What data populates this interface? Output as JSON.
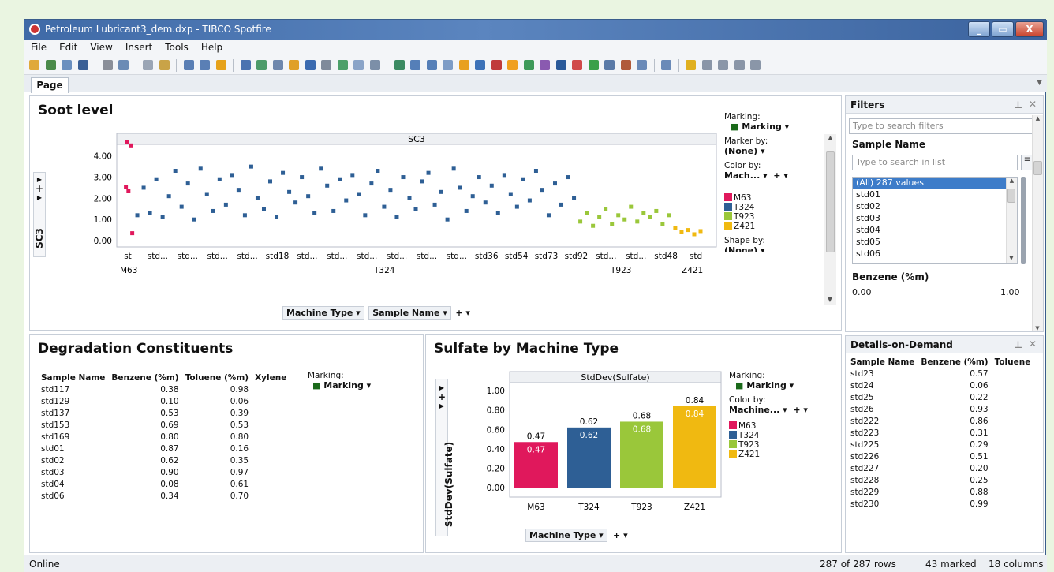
{
  "window": {
    "title": "Petroleum Lubricant3_dem.dxp - TIBCO Spotfire"
  },
  "menu": [
    "File",
    "Edit",
    "View",
    "Insert",
    "Tools",
    "Help"
  ],
  "tabs": [
    "Page"
  ],
  "soot": {
    "title": "Soot level",
    "plot_title": "SC3",
    "ylabel": "SC3",
    "yticks": [
      "4.00",
      "3.00",
      "2.00",
      "1.00",
      "0.00"
    ],
    "xticks": [
      "st",
      "std...",
      "std...",
      "std...",
      "std...",
      "std18",
      "std...",
      "std...",
      "std...",
      "std...",
      "std...",
      "std...",
      "std36",
      "std54",
      "std73",
      "std92",
      "std...",
      "std...",
      "std48",
      "std"
    ],
    "groups": [
      "M63",
      "T324",
      "T923",
      "Z421"
    ],
    "axis_controls": [
      "Machine Type",
      "Sample Name"
    ],
    "marking_label": "Marking:",
    "marking_value": "Marking",
    "marker_by_label": "Marker by:",
    "marker_by_value": "(None)",
    "color_by_label": "Color by:",
    "color_by_value": "Mach...",
    "legend": [
      "M63",
      "T324",
      "T923",
      "Z421"
    ],
    "shape_by_label": "Shape by:",
    "shape_by_value": "(None)"
  },
  "degradation": {
    "title": "Degradation Constituents",
    "columns": [
      "Sample Name",
      "Benzene (%m)",
      "Toluene (%m)",
      "Xylene"
    ],
    "rows": [
      [
        "std117",
        "0.38",
        "0.98"
      ],
      [
        "std129",
        "0.10",
        "0.06"
      ],
      [
        "std137",
        "0.53",
        "0.39"
      ],
      [
        "std153",
        "0.69",
        "0.53"
      ],
      [
        "std169",
        "0.80",
        "0.80"
      ],
      [
        "std01",
        "0.87",
        "0.16"
      ],
      [
        "std02",
        "0.62",
        "0.35"
      ],
      [
        "std03",
        "0.90",
        "0.97"
      ],
      [
        "std04",
        "0.08",
        "0.61"
      ],
      [
        "std06",
        "0.34",
        "0.70"
      ]
    ],
    "marking_label": "Marking:",
    "marking_value": "Marking"
  },
  "sulfate": {
    "title": "Sulfate by Machine Type",
    "plot_title": "StdDev(Sulfate)",
    "ylabel": "StdDev(Sulfate)",
    "axis_control": "Machine Type",
    "marking_label": "Marking:",
    "marking_value": "Marking",
    "color_by_label": "Color by:",
    "color_by_value": "Machine...",
    "legend": [
      "M63",
      "T324",
      "T923",
      "Z421"
    ]
  },
  "filters": {
    "title": "Filters",
    "search_placeholder": "Type to search filters",
    "sample_name_label": "Sample Name",
    "list_placeholder": "Type to search in list",
    "items": [
      "(All) 287 values",
      "std01",
      "std02",
      "std03",
      "std04",
      "std05",
      "std06"
    ],
    "benzene_label": "Benzene (%m)",
    "benzene_min": "0.00",
    "benzene_max": "1.00"
  },
  "details": {
    "title": "Details-on-Demand",
    "columns": [
      "Sample Name",
      "Benzene (%m)",
      "Toluene"
    ],
    "rows": [
      [
        "std23",
        "0.57"
      ],
      [
        "std24",
        "0.06"
      ],
      [
        "std25",
        "0.22"
      ],
      [
        "std26",
        "0.93"
      ],
      [
        "std222",
        "0.86"
      ],
      [
        "std223",
        "0.31"
      ],
      [
        "std225",
        "0.29"
      ],
      [
        "std226",
        "0.51"
      ],
      [
        "std227",
        "0.20"
      ],
      [
        "std228",
        "0.25"
      ],
      [
        "std229",
        "0.88"
      ],
      [
        "std230",
        "0.99"
      ]
    ]
  },
  "status": {
    "left": "Online",
    "rows": "287 of 287 rows",
    "marked": "43 marked",
    "columns": "18 columns"
  },
  "colors": {
    "M63": "#e0185c",
    "T324": "#2e5f95",
    "T923": "#9ac73a",
    "Z421": "#f0b911",
    "accent": "#3b6fb6"
  },
  "chart_data": [
    {
      "type": "scatter",
      "title": "SC3",
      "ylabel": "SC3",
      "xlabel": "",
      "ylim": [
        0,
        4.4
      ],
      "categories": [
        "M63",
        "T324",
        "T923",
        "Z421"
      ],
      "series": [
        {
          "name": "M63",
          "points": [
            [
              0.2,
              4.65
            ],
            [
              0.5,
              4.5
            ],
            [
              0.1,
              2.55
            ],
            [
              0.3,
              2.35
            ],
            [
              0.6,
              0.35
            ]
          ]
        },
        {
          "name": "T324",
          "points": [
            [
              1,
              1.2
            ],
            [
              1.5,
              2.5
            ],
            [
              2,
              1.3
            ],
            [
              2.5,
              2.9
            ],
            [
              3,
              1.1
            ],
            [
              3.5,
              2.1
            ],
            [
              4,
              3.3
            ],
            [
              4.5,
              1.6
            ],
            [
              5,
              2.7
            ],
            [
              5.5,
              1.0
            ],
            [
              6,
              3.4
            ],
            [
              6.5,
              2.2
            ],
            [
              7,
              1.4
            ],
            [
              7.5,
              2.9
            ],
            [
              8,
              1.7
            ],
            [
              8.5,
              3.1
            ],
            [
              9,
              2.4
            ],
            [
              9.5,
              1.2
            ],
            [
              10,
              3.5
            ],
            [
              10.5,
              2.0
            ],
            [
              11,
              1.5
            ],
            [
              11.5,
              2.8
            ],
            [
              12,
              1.1
            ],
            [
              12.5,
              3.2
            ],
            [
              13,
              2.3
            ],
            [
              13.5,
              1.8
            ],
            [
              14,
              3.0
            ],
            [
              14.5,
              2.1
            ],
            [
              15,
              1.3
            ],
            [
              15.5,
              3.4
            ],
            [
              16,
              2.6
            ],
            [
              16.5,
              1.4
            ],
            [
              17,
              2.9
            ],
            [
              17.5,
              1.9
            ],
            [
              18,
              3.1
            ],
            [
              18.5,
              2.2
            ],
            [
              19,
              1.2
            ],
            [
              19.5,
              2.7
            ],
            [
              20,
              3.3
            ],
            [
              20.5,
              1.6
            ],
            [
              21,
              2.4
            ],
            [
              21.5,
              1.1
            ],
            [
              22,
              3.0
            ],
            [
              22.5,
              2.0
            ],
            [
              23,
              1.5
            ],
            [
              23.5,
              2.8
            ],
            [
              24,
              3.2
            ],
            [
              24.5,
              1.7
            ],
            [
              25,
              2.3
            ],
            [
              25.5,
              1.0
            ],
            [
              26,
              3.4
            ],
            [
              26.5,
              2.5
            ],
            [
              27,
              1.4
            ],
            [
              27.5,
              2.1
            ],
            [
              28,
              3.0
            ],
            [
              28.5,
              1.8
            ],
            [
              29,
              2.6
            ],
            [
              29.5,
              1.3
            ],
            [
              30,
              3.1
            ],
            [
              30.5,
              2.2
            ],
            [
              31,
              1.6
            ],
            [
              31.5,
              2.9
            ],
            [
              32,
              1.9
            ],
            [
              32.5,
              3.3
            ],
            [
              33,
              2.4
            ],
            [
              33.5,
              1.2
            ],
            [
              34,
              2.7
            ],
            [
              34.5,
              1.7
            ],
            [
              35,
              3.0
            ],
            [
              35.5,
              2.0
            ]
          ]
        },
        {
          "name": "T923",
          "points": [
            [
              36,
              0.9
            ],
            [
              36.5,
              1.3
            ],
            [
              37,
              0.7
            ],
            [
              37.5,
              1.1
            ],
            [
              38,
              1.5
            ],
            [
              38.5,
              0.8
            ],
            [
              39,
              1.2
            ],
            [
              39.5,
              1.0
            ],
            [
              40,
              1.6
            ],
            [
              40.5,
              0.9
            ],
            [
              41,
              1.3
            ],
            [
              41.5,
              1.1
            ],
            [
              42,
              1.4
            ],
            [
              42.5,
              0.8
            ],
            [
              43,
              1.2
            ]
          ]
        },
        {
          "name": "Z421",
          "points": [
            [
              43.5,
              0.6
            ],
            [
              44,
              0.4
            ],
            [
              44.5,
              0.5
            ],
            [
              45,
              0.3
            ],
            [
              45.5,
              0.45
            ]
          ]
        }
      ]
    },
    {
      "type": "bar",
      "title": "StdDev(Sulfate)",
      "xlabel": "Machine Type",
      "ylabel": "StdDev(Sulfate)",
      "ylim": [
        0,
        1.05
      ],
      "categories": [
        "M63",
        "T324",
        "T923",
        "Z421"
      ],
      "values": [
        0.47,
        0.62,
        0.68,
        0.84
      ],
      "yticks": [
        "1.00",
        "0.80",
        "0.60",
        "0.40",
        "0.20",
        "0.00"
      ]
    }
  ]
}
